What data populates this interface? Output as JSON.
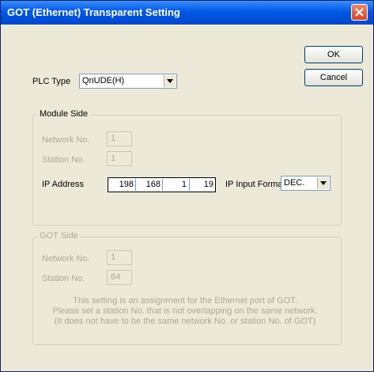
{
  "window": {
    "title": "GOT (Ethernet) Transparent Setting"
  },
  "buttons": {
    "ok": "OK",
    "cancel": "Cancel"
  },
  "plc_type": {
    "label": "PLC Type",
    "value": "QnUDE(H)"
  },
  "module_side": {
    "legend": "Module Side",
    "network_no_label": "Network No.",
    "network_no": "1",
    "station_no_label": "Station No.",
    "station_no": "1",
    "ip_address_label": "IP Address",
    "ip_octets": [
      "198",
      "168",
      "1",
      "19"
    ],
    "ip_input_format_label": "IP Input Format",
    "ip_input_format": "DEC."
  },
  "got_side": {
    "legend": "GOT Side",
    "network_no_label": "Network No.",
    "network_no": "1",
    "station_no_label": "Station No.",
    "station_no": "64",
    "note_lines": [
      "This setting is an assignment for the Ethernet port of GOT.",
      "Please set a station No. that is not overlapping on the same network.",
      "(It does not have to be the same network No. or station No. of GOT)"
    ]
  }
}
